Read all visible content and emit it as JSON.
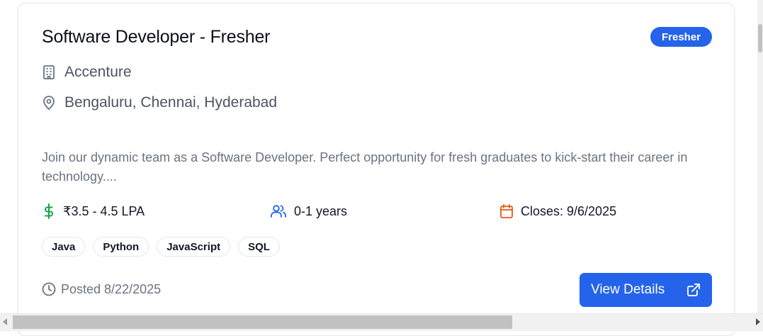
{
  "job": {
    "title": "Software Developer - Fresher",
    "badge": "Fresher",
    "company": "Accenture",
    "location": "Bengaluru, Chennai, Hyderabad",
    "description": "Join our dynamic team as a Software Developer. Perfect opportunity for fresh graduates to kick-start their career in technology....",
    "salary": "₹3.5 - 4.5 LPA",
    "experience": "0-1 years",
    "closes": "Closes: 9/6/2025",
    "skills": [
      "Java",
      "Python",
      "JavaScript",
      "SQL"
    ],
    "posted": "Posted 8/22/2025",
    "action_label": "View Details"
  },
  "icons": {
    "company": "building-icon",
    "location": "map-pin-icon",
    "salary": "dollar-icon",
    "experience": "users-icon",
    "closes": "calendar-icon",
    "posted": "clock-icon",
    "action": "external-link-icon"
  },
  "colors": {
    "accent": "#2563eb",
    "salary_icon": "#16a34a",
    "experience_icon": "#2563eb",
    "closes_icon": "#ea580c"
  }
}
